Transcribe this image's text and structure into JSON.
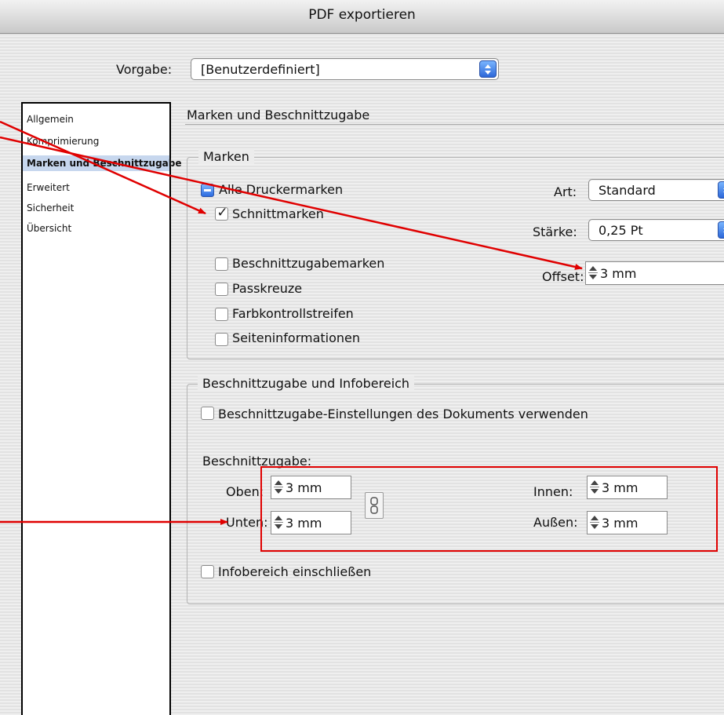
{
  "window": {
    "title": "PDF exportieren"
  },
  "preset": {
    "label": "Vorgabe:",
    "value": "[Benutzerdefiniert]"
  },
  "sidebar": {
    "items": [
      {
        "label": "Allgemein"
      },
      {
        "label": "Komprimierung"
      },
      {
        "label": "Marken und Beschnittzugabe"
      },
      {
        "label": "Erweitert"
      },
      {
        "label": "Sicherheit"
      },
      {
        "label": "Übersicht"
      }
    ]
  },
  "panel": {
    "title": "Marken und Beschnittzugabe",
    "marks": {
      "legend": "Marken",
      "all_printer_marks": "Alle Druckermarken",
      "options": [
        {
          "label": "Schnittmarken",
          "checked": true
        },
        {
          "label": "Beschnittzugabemarken",
          "checked": false
        },
        {
          "label": "Passkreuze",
          "checked": false
        },
        {
          "label": "Farbkontrollstreifen",
          "checked": false
        },
        {
          "label": "Seiteninformationen",
          "checked": false
        }
      ],
      "type_label": "Art:",
      "type_value": "Standard",
      "weight_label": "Stärke:",
      "weight_value": "0,25 Pt",
      "offset_label": "Offset:",
      "offset_value": "3 mm"
    },
    "bleed": {
      "legend": "Beschnittzugabe und Infobereich",
      "use_doc_settings": "Beschnittzugabe-Einstellungen des Dokuments verwenden",
      "bleed_label": "Beschnittzugabe:",
      "top_label": "Oben:",
      "top_value": "3 mm",
      "bottom_label": "Unten:",
      "bottom_value": "3 mm",
      "inside_label": "Innen:",
      "inside_value": "3 mm",
      "outside_label": "Außen:",
      "outside_value": "3 mm",
      "include_slug": "Infobereich einschließen"
    }
  },
  "colors": {
    "annotation": "#e00000",
    "selection": "#c7d7ee",
    "accent": "#2c67d8"
  },
  "icons": {
    "stepper": "stepper-arrows-icon",
    "popup": "popup-arrows-icon",
    "chain": "chain-link-icon"
  }
}
